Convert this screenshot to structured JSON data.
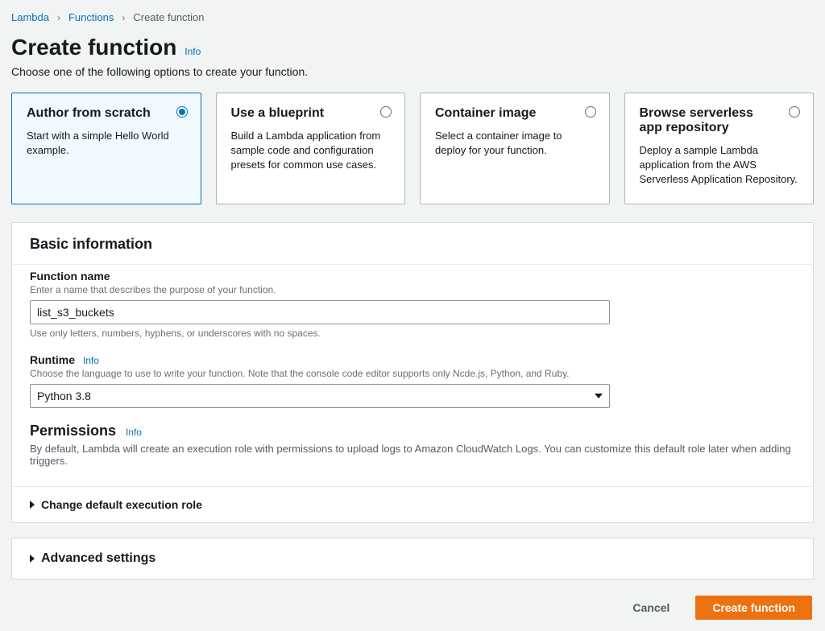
{
  "breadcrumb": {
    "items": [
      "Lambda",
      "Functions"
    ],
    "current": "Create function"
  },
  "header": {
    "title": "Create function",
    "info": "Info",
    "subtitle": "Choose one of the following options to create your function."
  },
  "options": [
    {
      "title": "Author from scratch",
      "desc": "Start with a simple Hello World example.",
      "selected": true
    },
    {
      "title": "Use a blueprint",
      "desc": "Build a Lambda application from sample code and configuration presets for common use cases.",
      "selected": false
    },
    {
      "title": "Container image",
      "desc": "Select a container image to deploy for your function.",
      "selected": false
    },
    {
      "title": "Browse serverless app repository",
      "desc": "Deploy a sample Lambda application from the AWS Serverless Application Repository.",
      "selected": false
    }
  ],
  "basic": {
    "heading": "Basic information",
    "functionName": {
      "label": "Function name",
      "hint": "Enter a name that describes the purpose of your function.",
      "value": "list_s3_buckets",
      "below": "Use only letters, numbers, hyphens, or underscores with no spaces."
    },
    "runtime": {
      "label": "Runtime",
      "info": "Info",
      "hint": "Choose the language to use to write your function. Note that the console code editor supports only Ncde.js, Python, and Ruby.",
      "value": "Python 3.8"
    },
    "permissions": {
      "label": "Permissions",
      "info": "Info",
      "desc": "By default, Lambda will create an execution role with permissions to upload logs to Amazon CloudWatch Logs. You can customize this default role later when adding triggers."
    },
    "changeRole": "Change default execution role"
  },
  "advanced": {
    "label": "Advanced settings"
  },
  "footer": {
    "cancel": "Cancel",
    "create": "Create function"
  }
}
